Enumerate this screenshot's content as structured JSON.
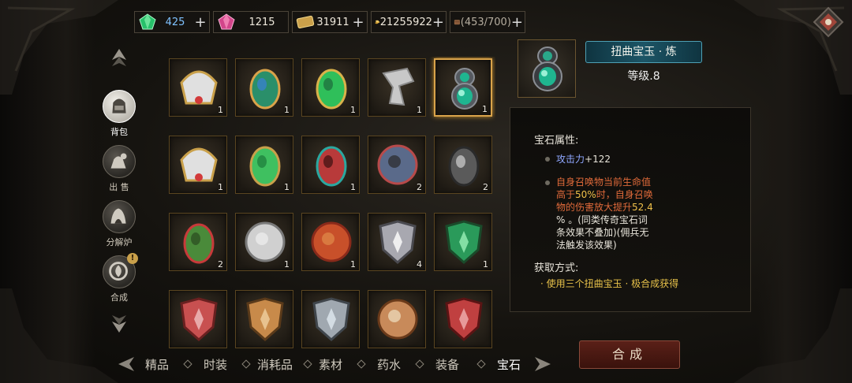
{
  "currencies": [
    {
      "icon": "green-gem-icon",
      "value": "425"
    },
    {
      "icon": "pink-gem-icon",
      "value": "1215"
    },
    {
      "icon": "gold-ticket-icon",
      "value": "31911"
    },
    {
      "icon": "gold-coins-icon",
      "value": "21255922"
    },
    {
      "icon": "bag-capacity-icon",
      "value": "(453/700)"
    }
  ],
  "side_nav": [
    {
      "label": "背包",
      "icon": "backpack-icon"
    },
    {
      "label": "出 售",
      "icon": "sell-bag-icon"
    },
    {
      "label": "分解炉",
      "icon": "furnace-icon"
    },
    {
      "label": "合成",
      "icon": "synthesis-icon",
      "badge": "!"
    }
  ],
  "inventory": [
    {
      "name": "gold-crest-gem",
      "qty": "1"
    },
    {
      "name": "rainbow-leaf-gem",
      "qty": "1"
    },
    {
      "name": "winged-emerald-gem",
      "qty": "1"
    },
    {
      "name": "silver-shard-gem",
      "qty": "1"
    },
    {
      "name": "twisted-jade-gem",
      "qty": "1"
    },
    {
      "name": "gold-crest-gem",
      "qty": "1"
    },
    {
      "name": "green-leaf-gem",
      "qty": "1"
    },
    {
      "name": "red-teal-gem",
      "qty": "1"
    },
    {
      "name": "chained-orb-gem",
      "qty": "2"
    },
    {
      "name": "dark-rock-gem",
      "qty": "2"
    },
    {
      "name": "mossy-ruby-gem",
      "qty": "2"
    },
    {
      "name": "lattice-stone-gem",
      "qty": "1"
    },
    {
      "name": "fire-ring-gem",
      "qty": "1"
    },
    {
      "name": "white-rune-shield-gem",
      "qty": "4"
    },
    {
      "name": "green-rune-shield-gem",
      "qty": "1"
    },
    {
      "name": "red-rune-shield-gem",
      "qty": ""
    },
    {
      "name": "amber-rune-shield-gem",
      "qty": ""
    },
    {
      "name": "silver-rune-shield-gem",
      "qty": ""
    },
    {
      "name": "bronze-sun-gem",
      "qty": ""
    },
    {
      "name": "crimson-rune-gem",
      "qty": ""
    }
  ],
  "selected_index": 4,
  "detail": {
    "name": "扭曲宝玉 · 炼",
    "level": "等级.8",
    "attr_heading": "宝石属性:",
    "attr_name": "攻击力",
    "attr_value": "+122",
    "effect_line1": "自身召唤物当前生命值",
    "effect_line2_a": "高于",
    "effect_line2_b": "50%",
    "effect_line2_c": "时，自身召唤",
    "effect_line3_a": "物的伤害放大提升",
    "effect_line3_b": "52.4",
    "effect_line4": "% 。(同类传奇宝石词",
    "effect_line5": "条效果不叠加)(佣兵无",
    "effect_line6": "法触发该效果)",
    "obtain_heading": "获取方式:",
    "obtain_text": "· 使用三个扭曲宝玉 · 极合成获得"
  },
  "craft_button": "合成",
  "tabs": [
    "精品",
    "时装",
    "消耗品",
    "素材",
    "药水",
    "装备",
    "宝石"
  ],
  "active_tab": "宝石"
}
